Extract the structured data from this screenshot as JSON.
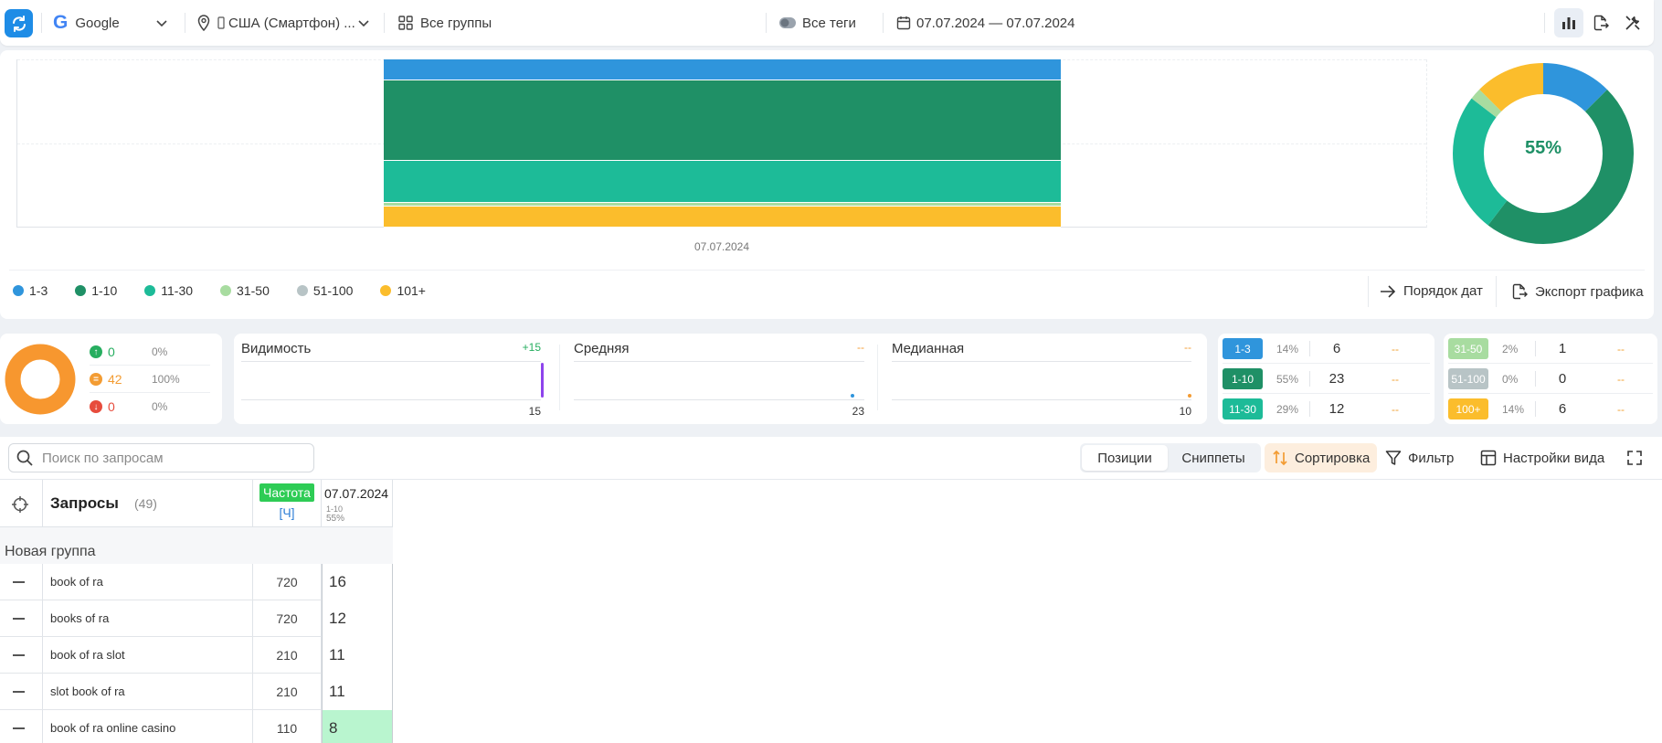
{
  "topbar": {
    "engine": "Google",
    "region": "США (Смартфон) ...",
    "groups": "Все группы",
    "tags": "Все теги",
    "date_range": "07.07.2024 — 07.07.2024"
  },
  "chart": {
    "x_label": "07.07.2024",
    "legend": [
      {
        "label": "1-3",
        "color": "#2f95dc"
      },
      {
        "label": "1-10",
        "color": "#1f9066"
      },
      {
        "label": "11-30",
        "color": "#1dbb98"
      },
      {
        "label": "31-50",
        "color": "#a8dca0"
      },
      {
        "label": "51-100",
        "color": "#b8c4c6"
      },
      {
        "label": "101+",
        "color": "#fbbd2c"
      }
    ],
    "actions": {
      "date_order": "Порядок дат",
      "export": "Экспорт графика"
    },
    "donut_center": "55%"
  },
  "chart_data": {
    "type": "bar",
    "categories": [
      "07.07.2024"
    ],
    "series": [
      {
        "name": "1-3",
        "values": [
          6
        ]
      },
      {
        "name": "1-10",
        "values": [
          23
        ]
      },
      {
        "name": "11-30",
        "values": [
          12
        ]
      },
      {
        "name": "31-50",
        "values": [
          1
        ]
      },
      {
        "name": "51-100",
        "values": [
          0
        ]
      },
      {
        "name": "101+",
        "values": [
          6
        ]
      }
    ],
    "stacked": true,
    "grid": true,
    "legend": "bottom"
  },
  "trend": {
    "up": {
      "value": "0",
      "pct": "0%",
      "color": "#27ae60"
    },
    "same": {
      "value": "42",
      "pct": "100%",
      "color": "#f39c33"
    },
    "down": {
      "value": "0",
      "pct": "0%",
      "color": "#e74c3c"
    }
  },
  "metrics": [
    {
      "title": "Видимость",
      "delta": "+15",
      "value": "15"
    },
    {
      "title": "Средняя",
      "delta": "--",
      "value": "23"
    },
    {
      "title": "Медианная",
      "delta": "--",
      "value": "10"
    }
  ],
  "ranges_left": [
    {
      "label": "1-3",
      "pct": "14%",
      "count": "6",
      "delta": "--",
      "color": "#2f95dc"
    },
    {
      "label": "1-10",
      "pct": "55%",
      "count": "23",
      "delta": "--",
      "color": "#1f9066"
    },
    {
      "label": "11-30",
      "pct": "29%",
      "count": "12",
      "delta": "--",
      "color": "#1dbb98"
    }
  ],
  "ranges_right": [
    {
      "label": "31-50",
      "pct": "2%",
      "count": "1",
      "delta": "--",
      "color": "#a8dca0"
    },
    {
      "label": "51-100",
      "pct": "0%",
      "count": "0",
      "delta": "--",
      "color": "#b8c4c6"
    },
    {
      "label": "100+",
      "pct": "14%",
      "count": "6",
      "delta": "--",
      "color": "#fbbd2c"
    }
  ],
  "toolbar": {
    "search_placeholder": "Поиск по запросам",
    "tab_positions": "Позиции",
    "tab_snippets": "Сниппеты",
    "sort": "Сортировка",
    "filter": "Фильтр",
    "view_settings": "Настройки вида"
  },
  "table": {
    "queries_title": "Запросы",
    "queries_count": "(49)",
    "freq_badge": "Частота",
    "freq_sub": "[Ч]",
    "date_col": "07.07.2024",
    "date_sub1": "1-10",
    "date_sub2": "55%",
    "group_name": "Новая группа",
    "rows": [
      {
        "query": "book of ra",
        "freq": "720",
        "pos": "16",
        "hl": false
      },
      {
        "query": "books of ra",
        "freq": "720",
        "pos": "12",
        "hl": false
      },
      {
        "query": "book of ra slot",
        "freq": "210",
        "pos": "11",
        "hl": false
      },
      {
        "query": "slot book of ra",
        "freq": "210",
        "pos": "11",
        "hl": false
      },
      {
        "query": "book of ra online casino",
        "freq": "110",
        "pos": "8",
        "hl": true
      }
    ]
  }
}
